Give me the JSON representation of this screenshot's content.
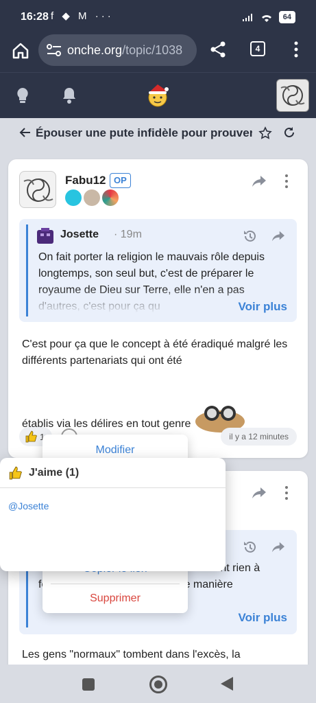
{
  "status": {
    "time": "16:28",
    "battery": "64",
    "app_icons": "f ◆ M ···"
  },
  "browser": {
    "url_domain": "onche.org",
    "url_path": "/topic/1038",
    "tab_count": "4"
  },
  "topic": {
    "title": "Épouser une pute infidèle pour prouver"
  },
  "post1": {
    "author": "Fabu12",
    "op_badge": "OP",
    "quote": {
      "author": "Josette",
      "time": "· 19m",
      "text": "On fait porter la religion le mauvais rôle depuis longtemps, son seul but, c'est de préparer le royaume de Dieu sur Terre, elle n'en a pas d'autres, c'est pour ça qu",
      "more": "Voir plus"
    },
    "text_line1": "C'est pour ça que le concept à été éradiqué malgré les différents partenariats qui ont été",
    "text_line2": "établis via les délires en tout genre",
    "like_count": "1",
    "time": "il y a 12 minutes"
  },
  "post2": {
    "quote_text": "... se rapproche de ... les gens \"... ment rien à foutre et se rapproche de lui de manière",
    "quote_more": "Voir plus",
    "text": "Les gens \"normaux\" tombent dans l'excès, la"
  },
  "context_menu": {
    "modify": "Modifier",
    "copy": "Copier le lien",
    "delete": "Supprimer"
  },
  "likes_popover": {
    "title": "J'aime (1)",
    "users": [
      "@Josette"
    ]
  },
  "colors": {
    "header": "#2d3447",
    "accent": "#3b82d6",
    "danger": "#d9463e"
  }
}
